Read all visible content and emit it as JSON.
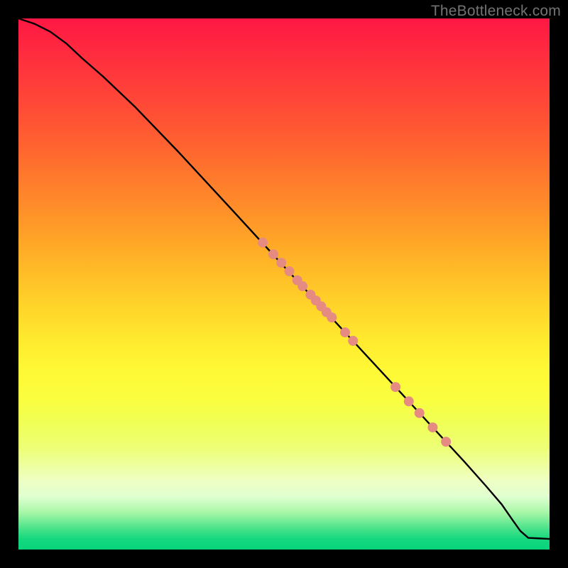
{
  "watermark": "TheBottleneck.com",
  "colors": {
    "line": "#000000",
    "marker_fill": "#e58b82",
    "marker_stroke": "#c06a60"
  },
  "chart_data": {
    "type": "line",
    "title": "",
    "xlabel": "",
    "ylabel": "",
    "xlim": [
      0,
      100
    ],
    "ylim": [
      0,
      100
    ],
    "grid": false,
    "legend": false,
    "series": [
      {
        "name": "curve",
        "x": [
          0,
          3,
          6,
          9,
          12,
          16,
          22,
          30,
          40,
          50,
          60,
          70,
          78,
          84,
          88,
          91,
          93,
          94.5,
          96,
          100
        ],
        "y": [
          100,
          99,
          97.5,
          95.3,
          92.5,
          89,
          83.3,
          75,
          64.2,
          53.3,
          42.5,
          31.7,
          23,
          16.5,
          12,
          8.5,
          5.6,
          3.5,
          2.2,
          2.0
        ]
      }
    ],
    "markers": {
      "name": "highlight-points",
      "x": [
        46,
        48,
        49.5,
        51,
        52.5,
        53.5,
        55,
        56,
        57,
        58,
        59,
        61.5,
        63,
        71,
        73.5,
        75.5,
        78,
        80.5
      ],
      "y": [
        57.8,
        55.6,
        54.0,
        52.4,
        50.7,
        49.6,
        48.0,
        46.9,
        45.8,
        44.7,
        43.7,
        40.9,
        39.3,
        30.6,
        27.9,
        25.7,
        23.0,
        20.3
      ],
      "r": 7
    }
  }
}
